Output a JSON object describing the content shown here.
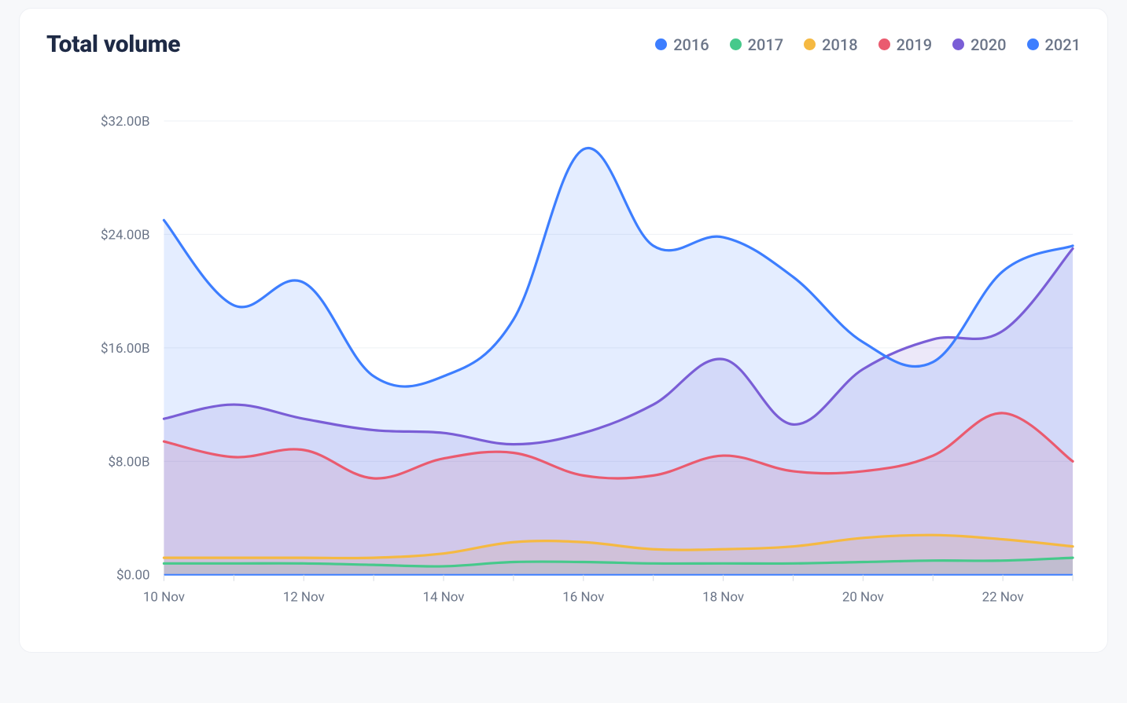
{
  "title": "Total volume",
  "legend": [
    {
      "label": "2016",
      "color": "#3d7eff"
    },
    {
      "label": "2017",
      "color": "#46c98b"
    },
    {
      "label": "2018",
      "color": "#f5b942"
    },
    {
      "label": "2019",
      "color": "#ea5b6f"
    },
    {
      "label": "2020",
      "color": "#7a5ed6"
    },
    {
      "label": "2021",
      "color": "#3d7eff"
    }
  ],
  "y_ticks": [
    "$0.00",
    "$8.00B",
    "$16.00B",
    "$24.00B",
    "$32.00B"
  ],
  "x_ticks": [
    "10 Nov",
    "12 Nov",
    "14 Nov",
    "16 Nov",
    "18 Nov",
    "20 Nov",
    "22 Nov"
  ],
  "chart_data": {
    "type": "area",
    "title": "Total volume",
    "xlabel": "",
    "ylabel": "",
    "ylim": [
      0,
      32
    ],
    "y_unit": "B USD",
    "x": [
      "10 Nov",
      "11 Nov",
      "12 Nov",
      "13 Nov",
      "14 Nov",
      "15 Nov",
      "16 Nov",
      "17 Nov",
      "18 Nov",
      "19 Nov",
      "20 Nov",
      "21 Nov",
      "22 Nov",
      "23 Nov"
    ],
    "series": [
      {
        "name": "2016",
        "color": "#3d7eff",
        "values": [
          0.05,
          0.05,
          0.05,
          0.05,
          0.05,
          0.05,
          0.05,
          0.05,
          0.05,
          0.05,
          0.05,
          0.05,
          0.05,
          0.05
        ]
      },
      {
        "name": "2017",
        "color": "#46c98b",
        "values": [
          0.8,
          0.8,
          0.8,
          0.7,
          0.6,
          0.9,
          0.9,
          0.8,
          0.8,
          0.8,
          0.9,
          1.0,
          1.0,
          1.2
        ]
      },
      {
        "name": "2018",
        "color": "#f5b942",
        "values": [
          1.2,
          1.2,
          1.2,
          1.2,
          1.5,
          2.3,
          2.3,
          1.8,
          1.8,
          2.0,
          2.6,
          2.8,
          2.5,
          2.0
        ]
      },
      {
        "name": "2019",
        "color": "#ea5b6f",
        "values": [
          9.4,
          8.3,
          8.8,
          6.8,
          8.2,
          8.6,
          7.0,
          7.0,
          8.4,
          7.3,
          7.3,
          8.4,
          11.4,
          8.0
        ]
      },
      {
        "name": "2020",
        "color": "#7a5ed6",
        "values": [
          11.0,
          12.0,
          11.0,
          10.2,
          10.0,
          9.2,
          10.0,
          12.0,
          15.2,
          10.6,
          14.5,
          16.6,
          17.2,
          23.0
        ]
      },
      {
        "name": "2021",
        "color": "#3d7eff",
        "values": [
          25.0,
          19.0,
          20.6,
          14.0,
          14.0,
          18.0,
          30.0,
          23.2,
          23.8,
          21.0,
          16.4,
          15.0,
          21.4,
          23.2
        ]
      }
    ],
    "legend_position": "top-right",
    "grid": "horizontal"
  }
}
